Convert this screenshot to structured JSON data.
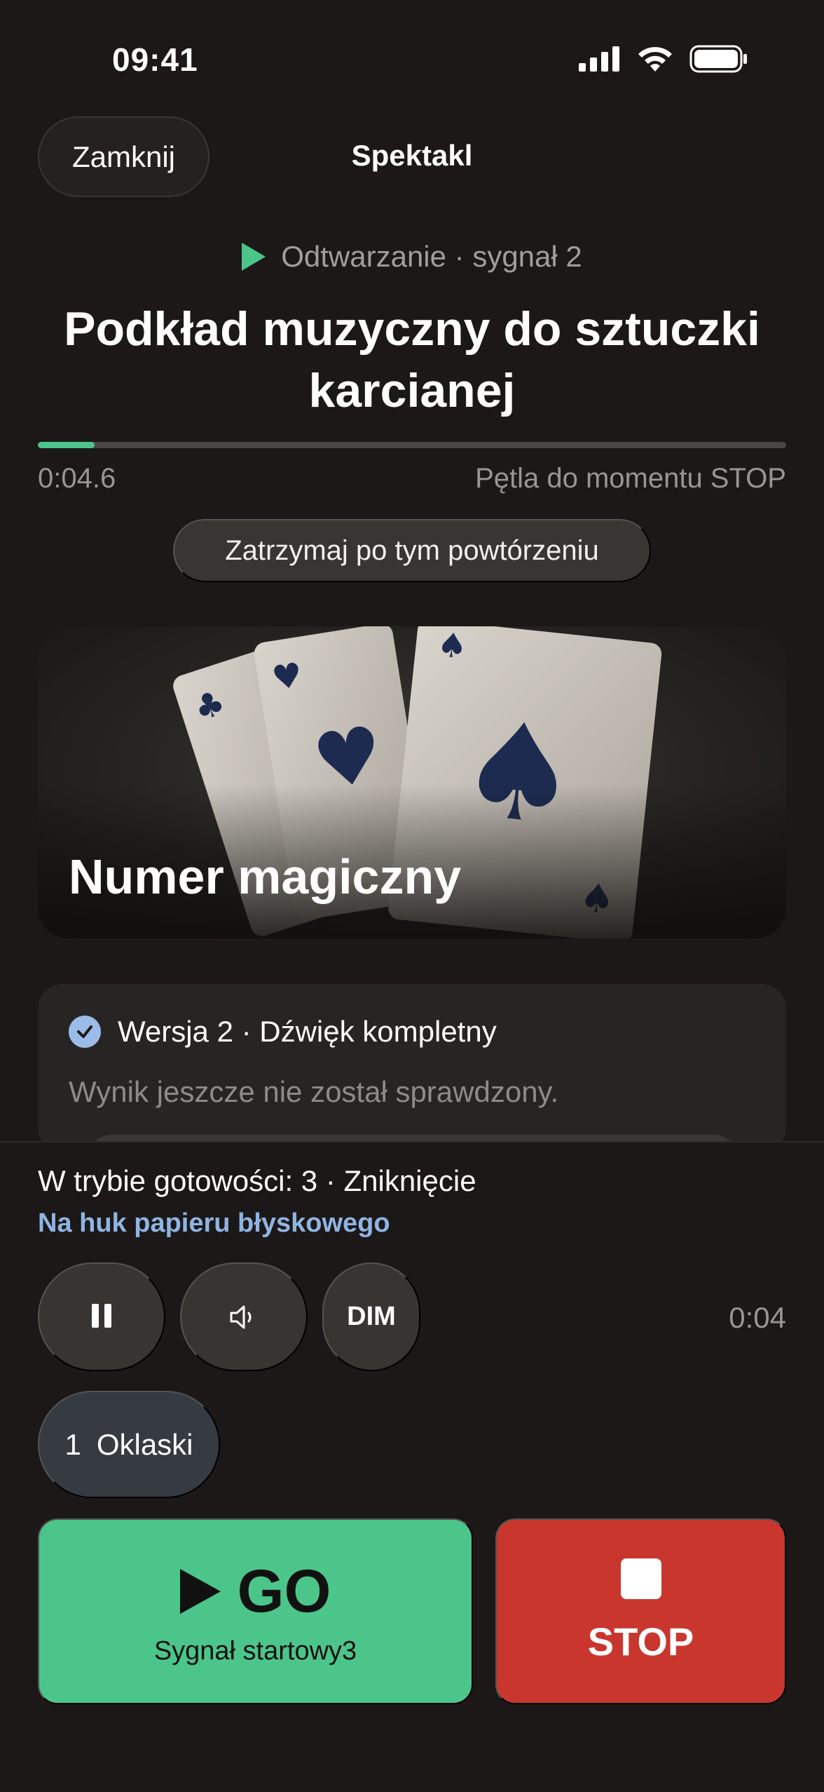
{
  "status_bar": {
    "time": "09:41",
    "signal_icon": "cellular-signal-icon",
    "wifi_icon": "wifi-icon",
    "battery_icon": "battery-icon"
  },
  "header": {
    "close_label": "Zamknij",
    "title": "Spektakl"
  },
  "now_playing": {
    "status": "Odtwarzanie · sygnał 2",
    "title": "Podkład muzyczny do sztuczki karcianej",
    "progress": 0.076,
    "elapsed": "0:04.6",
    "loop_info": "Pętla do momentu STOP",
    "stop_after_label": "Zatrzymaj po tym powtórzeniu",
    "accent_color": "#4cc58a"
  },
  "hero": {
    "title": "Numer magiczny"
  },
  "version_card": {
    "title": "Wersja 2 · Dźwięk kompletny",
    "note": "Wynik jeszcze nie został sprawdzony."
  },
  "next_cue": {
    "standby": "W trybie gotowości: 3 · Zniknięcie",
    "trigger": "Na huk papieru błyskowego"
  },
  "controls": {
    "pause_icon": "pause-icon",
    "volume_icon": "speaker-icon",
    "dim_label": "DIM",
    "time": "0:04"
  },
  "cue_chip": {
    "number": "1",
    "label": "Oklaski"
  },
  "go_button": {
    "label": "GO",
    "sublabel": "Sygnał startowy3",
    "color": "#4cc58a"
  },
  "stop_button": {
    "label": "STOP",
    "color": "#c9362e"
  }
}
